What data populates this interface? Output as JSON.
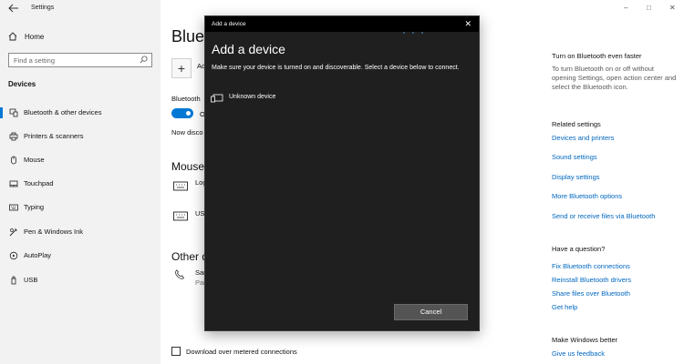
{
  "app": {
    "title": "Settings"
  },
  "sidebar": {
    "home": "Home",
    "search_placeholder": "Find a setting",
    "section": "Devices",
    "items": [
      {
        "label": "Bluetooth & other devices",
        "icon": "bluetooth-devices-icon",
        "active": true
      },
      {
        "label": "Printers & scanners",
        "icon": "printer-icon"
      },
      {
        "label": "Mouse",
        "icon": "mouse-icon"
      },
      {
        "label": "Touchpad",
        "icon": "touchpad-icon"
      },
      {
        "label": "Typing",
        "icon": "keyboard-icon"
      },
      {
        "label": "Pen & Windows Ink",
        "icon": "pen-icon"
      },
      {
        "label": "AutoPlay",
        "icon": "autoplay-icon"
      },
      {
        "label": "USB",
        "icon": "usb-icon"
      }
    ]
  },
  "main": {
    "title": "Blueto",
    "add_label": "Ac",
    "bluetooth_label": "Bluetooth",
    "toggle_label": "O",
    "now_discoverable": "Now disco",
    "mouse_heading": "Mouse,",
    "devices": [
      "Log",
      "USI"
    ],
    "other_heading": "Other d",
    "other_device": "San",
    "other_device_sub": "Pai",
    "metered": "Download over metered connections"
  },
  "right": {
    "faster_title": "Turn on Bluetooth even faster",
    "faster_text": "To turn Bluetooth on or off without opening Settings, open action center and select the Bluetooth icon.",
    "related_title": "Related settings",
    "related_links": [
      "Devices and printers",
      "Sound settings",
      "Display settings",
      "More Bluetooth options",
      "Send or receive files via Bluetooth"
    ],
    "question_title": "Have a question?",
    "question_links": [
      "Fix Bluetooth connections",
      "Reinstall Bluetooth drivers",
      "Share files over Bluetooth",
      "Get help"
    ],
    "better_title": "Make Windows better",
    "better_link": "Give us feedback"
  },
  "dialog": {
    "window_title": "Add a device",
    "heading": "Add a device",
    "description": "Make sure your device is turned on and discoverable. Select a device below to connect.",
    "device_label": "Unknown device",
    "cancel_label": "Cancel"
  },
  "colors": {
    "accent": "#0078d4",
    "link": "#0067c0",
    "dialog_bg": "#1f1f1f"
  }
}
